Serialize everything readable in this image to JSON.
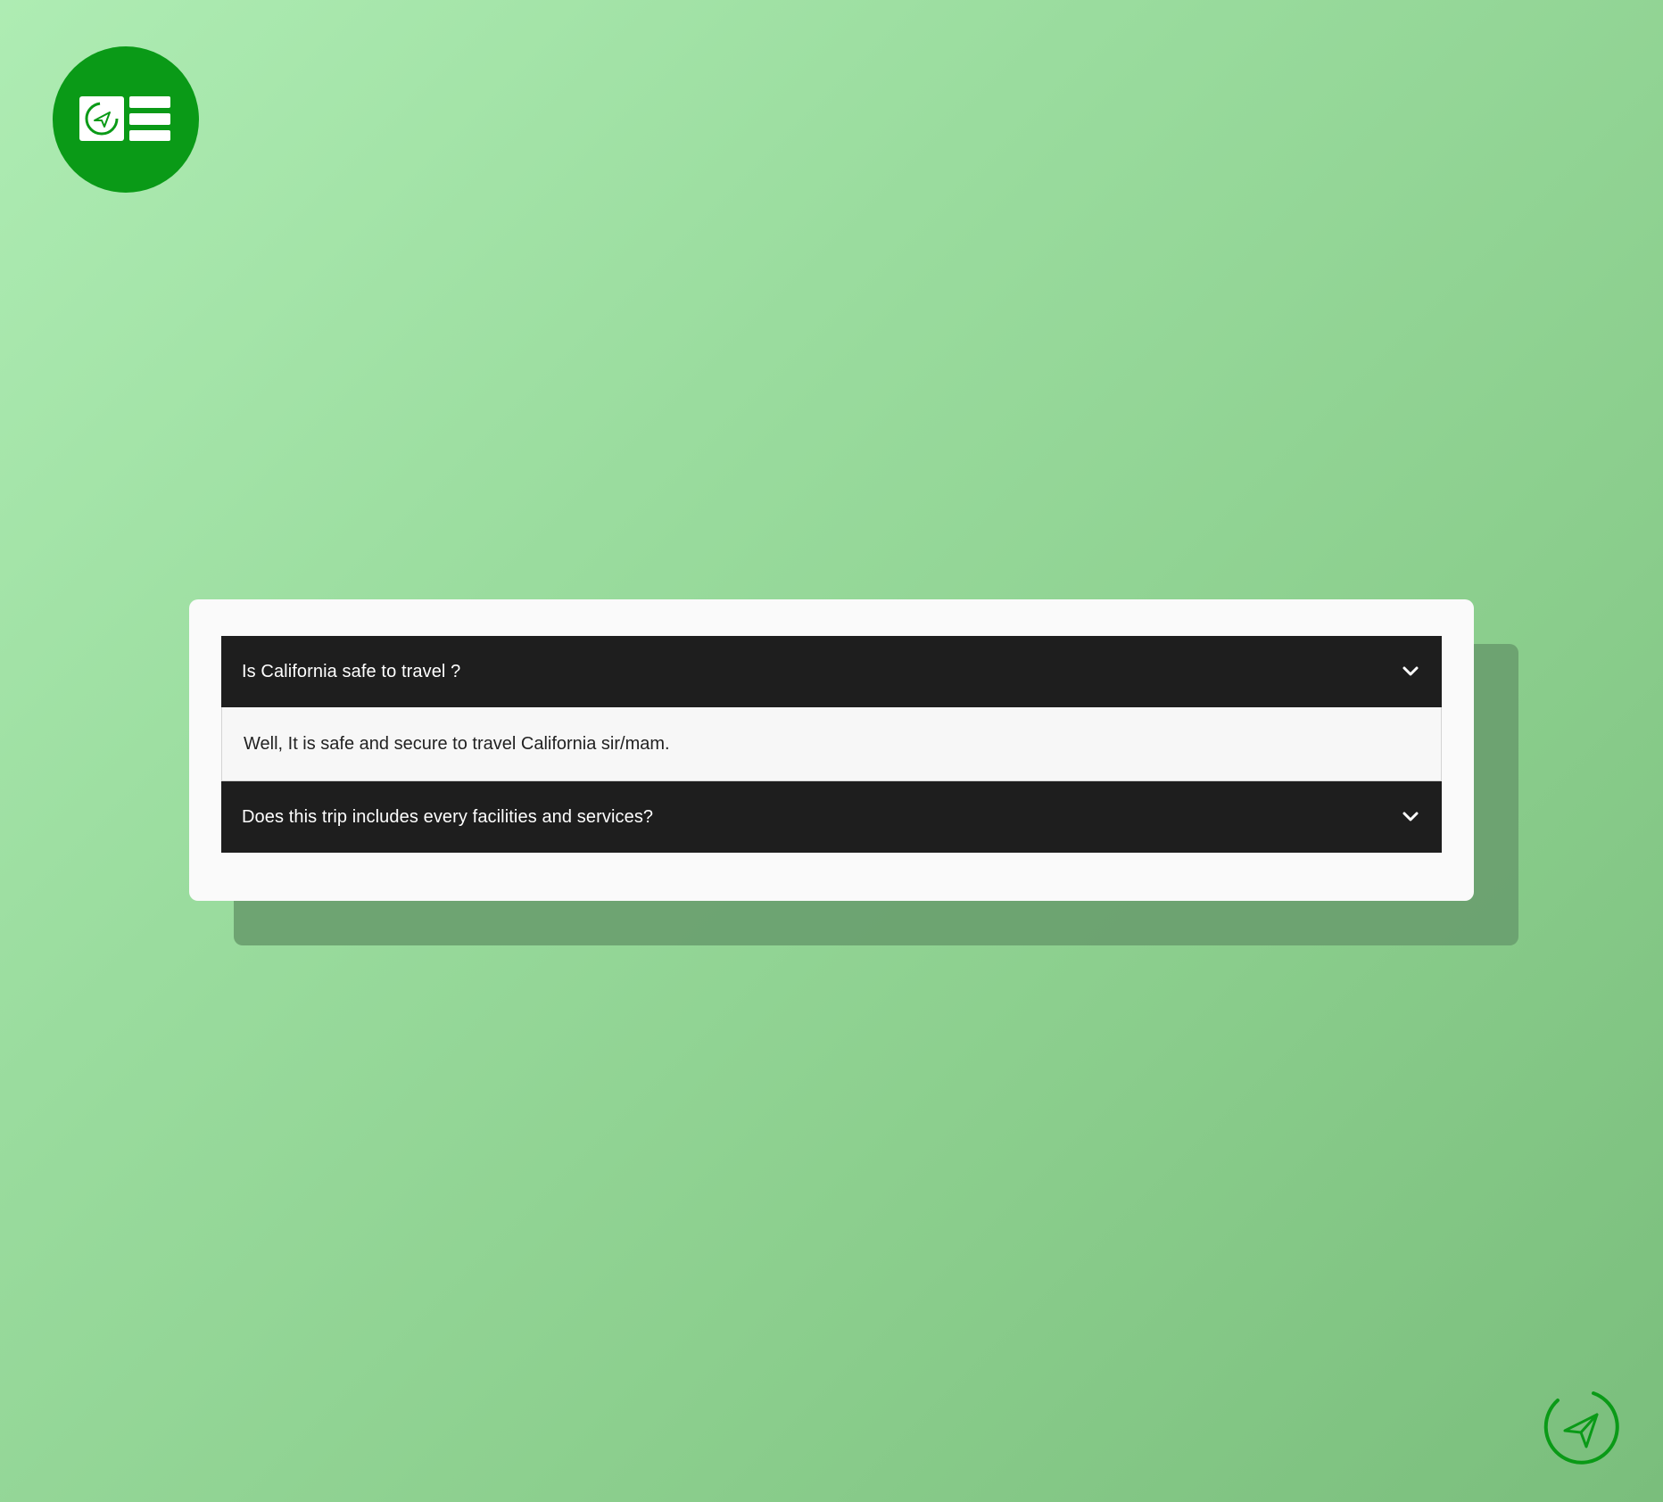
{
  "brand": {
    "logo_icon": "travel-news-logo-icon",
    "accent_color": "#0a9a17",
    "badge_icon": "paper-plane-icon"
  },
  "faq": {
    "items": [
      {
        "question": "Is California safe to travel ?",
        "answer": "Well, It is safe and secure to travel California sir/mam.",
        "expanded": true
      },
      {
        "question": "Does this trip includes every facilities and services?",
        "answer": "",
        "expanded": false
      }
    ]
  },
  "colors": {
    "header_bg": "#1e1e1e",
    "card_bg": "#fafafa",
    "page_gradient_start": "#aeecb3",
    "page_gradient_end": "#7abe7c"
  }
}
